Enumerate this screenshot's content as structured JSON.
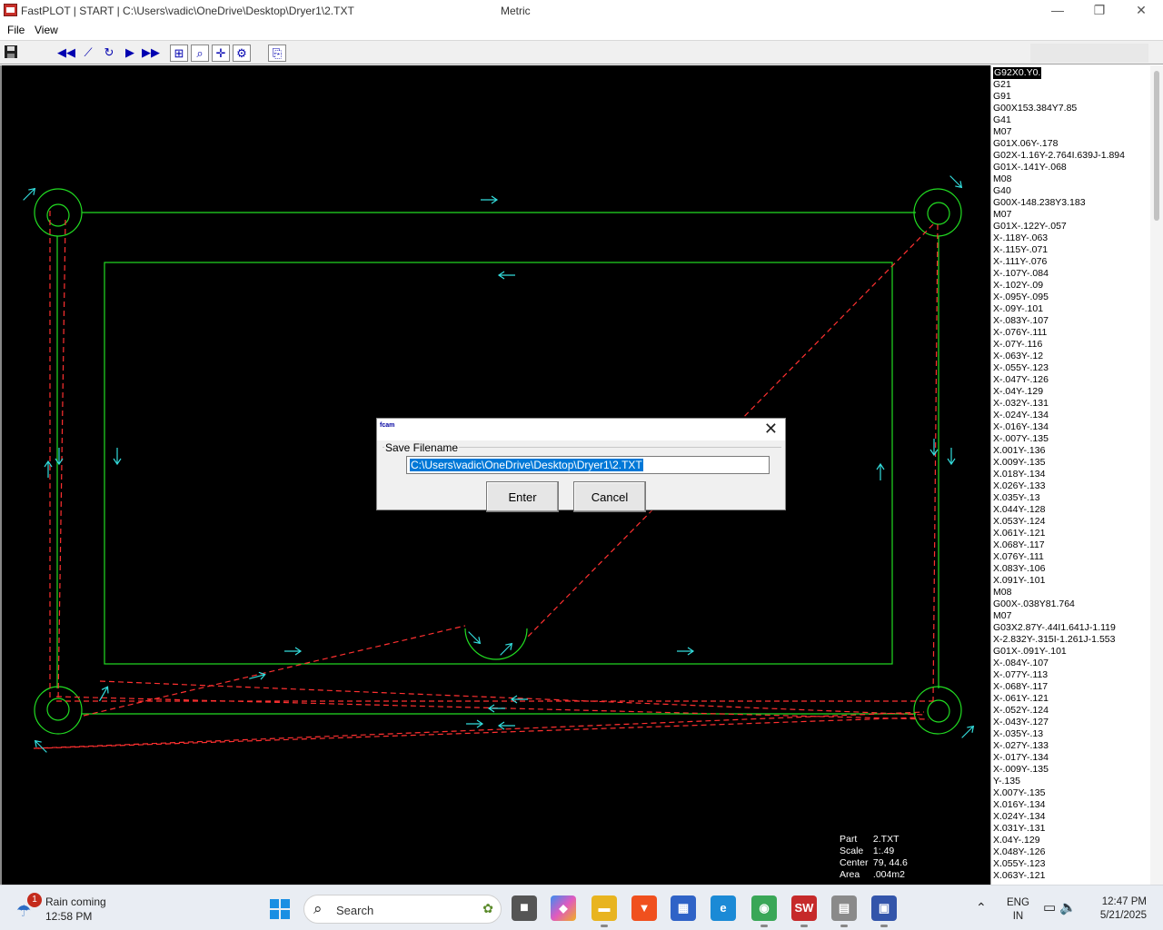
{
  "window": {
    "title": "FastPLOT  |  START  |  C:\\Users\\vadic\\OneDrive\\Desktop\\Dryer1\\2.TXT",
    "mode": "Metric",
    "minimize_glyph": "—",
    "maximize_glyph": "❐",
    "close_glyph": "✕"
  },
  "menu": {
    "file": "File",
    "view": "View"
  },
  "toolbar": {
    "save_icon": "save-icon",
    "buttons": [
      {
        "name": "rewind-button",
        "glyph": "◀◀"
      },
      {
        "name": "plot-button",
        "glyph": "⟋"
      },
      {
        "name": "redraw-button",
        "glyph": "↻"
      },
      {
        "name": "play-button",
        "glyph": "▶"
      },
      {
        "name": "fast-forward-button",
        "glyph": "▶▶"
      },
      {
        "name": "measure-button",
        "glyph": "⊞"
      },
      {
        "name": "zoom-button",
        "glyph": "⌕"
      },
      {
        "name": "fit-button",
        "glyph": "✛"
      },
      {
        "name": "settings-button",
        "glyph": "⚙"
      },
      {
        "name": "export-button",
        "glyph": "⎘"
      }
    ]
  },
  "colors": {
    "part": "#22dd22",
    "rapid": "#ff3030",
    "arrow": "#33dddd"
  },
  "info": {
    "part_label": "Part",
    "part_value": "2.TXT",
    "scale_label": "Scale",
    "scale_value": "1:.49",
    "center_label": "Center",
    "center_value": "79, 44.6",
    "area_label": "Area",
    "area_value": ".004m2"
  },
  "gcode": [
    "G92X0.Y0.",
    "G21",
    "G91",
    "G00X153.384Y7.85",
    "G41",
    "M07",
    "G01X.06Y-.178",
    "G02X-1.16Y-2.764I.639J-1.894",
    "G01X-.141Y-.068",
    "M08",
    "G40",
    "G00X-148.238Y3.183",
    "M07",
    "G01X-.122Y-.057",
    "X-.118Y-.063",
    "X-.115Y-.071",
    "X-.111Y-.076",
    "X-.107Y-.084",
    "X-.102Y-.09",
    "X-.095Y-.095",
    "X-.09Y-.101",
    "X-.083Y-.107",
    "X-.076Y-.111",
    "X-.07Y-.116",
    "X-.063Y-.12",
    "X-.055Y-.123",
    "X-.047Y-.126",
    "X-.04Y-.129",
    "X-.032Y-.131",
    "X-.024Y-.134",
    "X-.016Y-.134",
    "X-.007Y-.135",
    "X.001Y-.136",
    "X.009Y-.135",
    "X.018Y-.134",
    "X.026Y-.133",
    "X.035Y-.13",
    "X.044Y-.128",
    "X.053Y-.124",
    "X.061Y-.121",
    "X.068Y-.117",
    "X.076Y-.111",
    "X.083Y-.106",
    "X.091Y-.101",
    "M08",
    "G00X-.038Y81.764",
    "M07",
    "G03X2.87Y-.44I1.641J-1.119",
    "X-2.832Y-.315I-1.261J-1.553",
    "G01X-.091Y-.101",
    "X-.084Y-.107",
    "X-.077Y-.113",
    "X-.068Y-.117",
    "X-.061Y-.121",
    "X-.052Y-.124",
    "X-.043Y-.127",
    "X-.035Y-.13",
    "X-.027Y-.133",
    "X-.017Y-.134",
    "X-.009Y-.135",
    "Y-.135",
    "X.007Y-.135",
    "X.016Y-.134",
    "X.024Y-.134",
    "X.031Y-.131",
    "X.04Y-.129",
    "X.048Y-.126",
    "X.055Y-.123",
    "X.063Y-.121"
  ],
  "dialog": {
    "icon_text": "fcam",
    "close_glyph": "✕",
    "group_label": "Save Filename",
    "filename": "C:\\Users\\vadic\\OneDrive\\Desktop\\Dryer1\\2.TXT",
    "enter_label": "Enter",
    "cancel_label": "Cancel"
  },
  "taskbar": {
    "weather_badge": "1",
    "weather_text": "Rain coming",
    "weather_time": "12:58 PM",
    "search_placeholder": "Search",
    "apps": [
      {
        "name": "file-explorer-taskbar-icon",
        "color": "#e8b420",
        "glyph": "▬"
      },
      {
        "name": "brave-taskbar-icon",
        "color": "#f0501e",
        "glyph": "▼"
      },
      {
        "name": "store-taskbar-icon",
        "color": "#2f63c7",
        "glyph": "▦"
      },
      {
        "name": "edge-taskbar-icon",
        "color": "#1b8ad6",
        "glyph": "e"
      },
      {
        "name": "chrome-taskbar-icon",
        "color": "#3aa757",
        "glyph": "◉"
      },
      {
        "name": "solidworks-taskbar-icon",
        "color": "#c62a2a",
        "glyph": "SW"
      },
      {
        "name": "fastcam-taskbar-icon",
        "color": "#8a8a8a",
        "glyph": "▤"
      },
      {
        "name": "fastplot-taskbar-icon",
        "color": "#3355aa",
        "glyph": "▣"
      }
    ],
    "lang_1": "ENG",
    "lang_2": "IN",
    "time": "12:47 PM",
    "date": "5/21/2025"
  }
}
